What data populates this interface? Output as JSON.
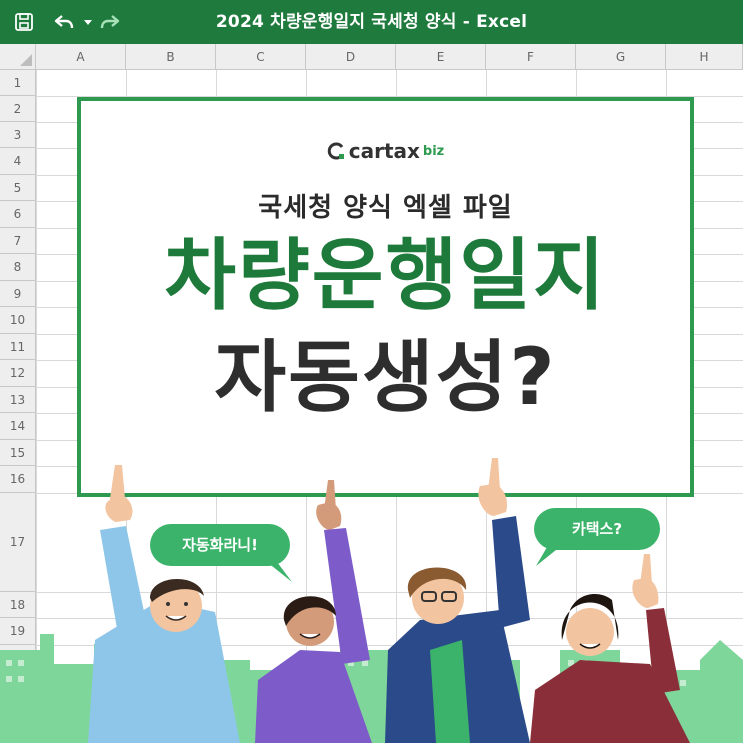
{
  "titlebar": {
    "title": "2024 차량운행일지 국세청 양식 - Excel",
    "icons": [
      "save-icon",
      "undo-icon",
      "dropdown-icon",
      "redo-icon"
    ],
    "color": "#1f7a3e"
  },
  "sheet": {
    "columns": [
      "A",
      "B",
      "C",
      "D",
      "E",
      "F",
      "G",
      "H"
    ],
    "rows": [
      "1",
      "2",
      "3",
      "4",
      "5",
      "6",
      "7",
      "8",
      "9",
      "10",
      "11",
      "12",
      "13",
      "14",
      "15",
      "16",
      "17",
      "18",
      "19"
    ]
  },
  "card": {
    "logo_text": "cartax",
    "logo_suffix": "biz",
    "subtitle": "국세청 양식 엑셀 파일",
    "headline_1": "차량운행일지",
    "headline_2": "자동생성?",
    "accent": "#2e9a4f",
    "headline_color": "#1e7a3a"
  },
  "bubbles": {
    "left": "자동화라니!",
    "right": "카택스?",
    "color": "#3cb36a"
  }
}
